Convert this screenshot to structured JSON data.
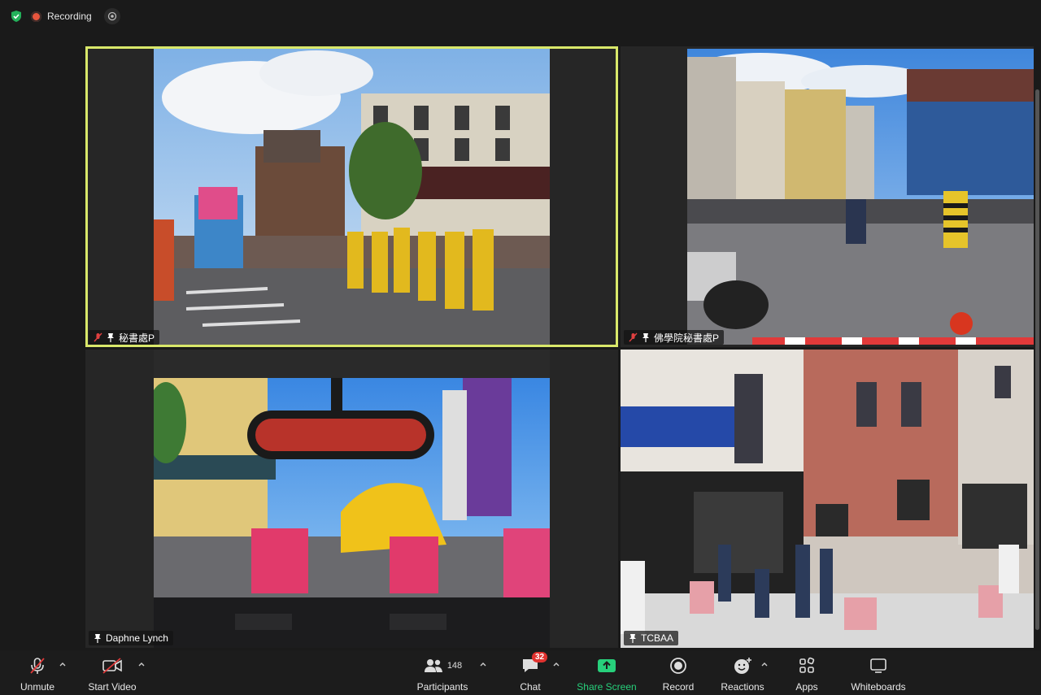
{
  "top": {
    "recording_label": "Recording"
  },
  "tiles": [
    {
      "name": "秘書處P",
      "muted": true
    },
    {
      "name": "佛學院秘書處P",
      "muted": true
    },
    {
      "name": "Daphne Lynch",
      "muted": false
    },
    {
      "name": "TCBAA",
      "muted": false
    }
  ],
  "toolbar": {
    "unmute": "Unmute",
    "start_video": "Start Video",
    "participants": "Participants",
    "participants_count": "148",
    "chat": "Chat",
    "chat_badge": "32",
    "share": "Share Screen",
    "record": "Record",
    "reactions": "Reactions",
    "apps": "Apps",
    "whiteboards": "Whiteboards"
  },
  "colors": {
    "active_speaker": "#d9e86a",
    "share_green": "#27d07b",
    "recording_red": "#e8553d"
  }
}
